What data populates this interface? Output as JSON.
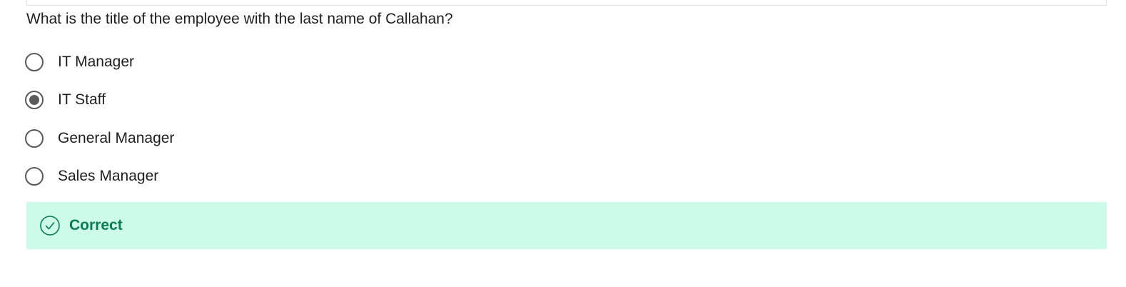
{
  "question": {
    "text": "What is the title of the employee with the last name of Callahan?"
  },
  "options": [
    {
      "label": "IT Manager",
      "selected": false
    },
    {
      "label": "IT Staff",
      "selected": true
    },
    {
      "label": "General Manager",
      "selected": false
    },
    {
      "label": "Sales Manager",
      "selected": false
    }
  ],
  "feedback": {
    "text": "Correct",
    "icon": "check-circle-icon",
    "color": "#0b7a55",
    "background": "#ccfbea"
  },
  "colors": {
    "radio": "#5a5a5a",
    "text": "#1f1f1f"
  }
}
